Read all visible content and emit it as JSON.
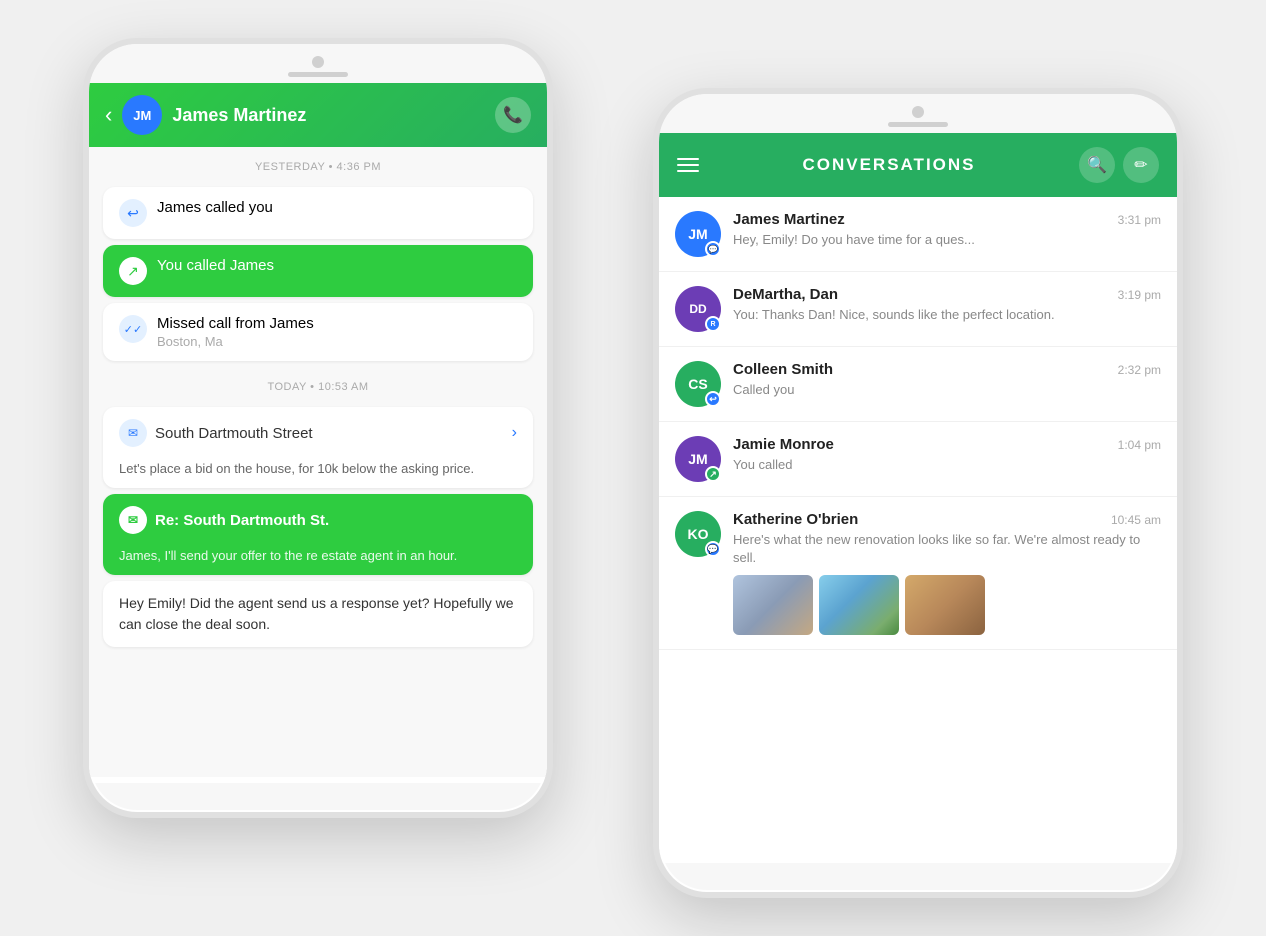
{
  "leftPhone": {
    "header": {
      "back": "‹",
      "avatarText": "JM",
      "name": "James Martinez",
      "phoneIcon": "📞"
    },
    "messages": [
      {
        "type": "timestamp",
        "text": "YESTERDAY • 4:36 PM"
      },
      {
        "type": "received-call",
        "icon": "↩",
        "title": "James called you"
      },
      {
        "type": "sent-call",
        "icon": "↗",
        "title": "You called James"
      },
      {
        "type": "missed-call",
        "icon": "✓✓",
        "title": "Missed call from James",
        "subtitle": "Boston, Ma"
      },
      {
        "type": "timestamp",
        "text": "TODAY • 10:53 AM"
      },
      {
        "type": "email-received",
        "title": "South Dartmouth Street",
        "body": "Let's place a bid on the house, for 10k below the asking price."
      },
      {
        "type": "email-sent",
        "icon": "✉",
        "title": "Re: South Dartmouth St.",
        "body": "James, I'll send your offer to the re estate agent in an hour."
      },
      {
        "type": "text-received",
        "body": "Hey Emily! Did the agent send us a response yet? Hopefully we can close the deal soon."
      }
    ]
  },
  "rightPhone": {
    "header": {
      "title": "CONVERSATIONS",
      "searchIcon": "🔍",
      "editIcon": "✏"
    },
    "conversations": [
      {
        "avatarText": "JM",
        "avatarColor": "av-blue",
        "name": "James Martinez",
        "time": "3:31 pm",
        "preview": "Hey, Emily! Do you have time for a ques...",
        "badgeIcon": "💬"
      },
      {
        "avatarText": "DD",
        "avatarColor": "av-purple",
        "name": "DeMartha, Dan",
        "time": "3:19 pm",
        "preview": "You: Thanks Dan! Nice, sounds like the perfect location.",
        "badgeIcon": "💬"
      },
      {
        "avatarText": "CS",
        "avatarColor": "av-green",
        "name": "Colleen Smith",
        "time": "2:32 pm",
        "preview": "Called you",
        "badgeIcon": "↩"
      },
      {
        "avatarText": "JM",
        "avatarColor": "av-purple",
        "name": "Jamie Monroe",
        "time": "1:04 pm",
        "preview": "You called",
        "badgeIcon": "↗"
      },
      {
        "avatarText": "KO",
        "avatarColor": "av-green",
        "name": "Katherine O'brien",
        "time": "10:45 am",
        "preview": "Here's what the new renovation looks like so far. We're almost ready to sell.",
        "hasImages": true,
        "badgeIcon": "💬"
      }
    ]
  }
}
